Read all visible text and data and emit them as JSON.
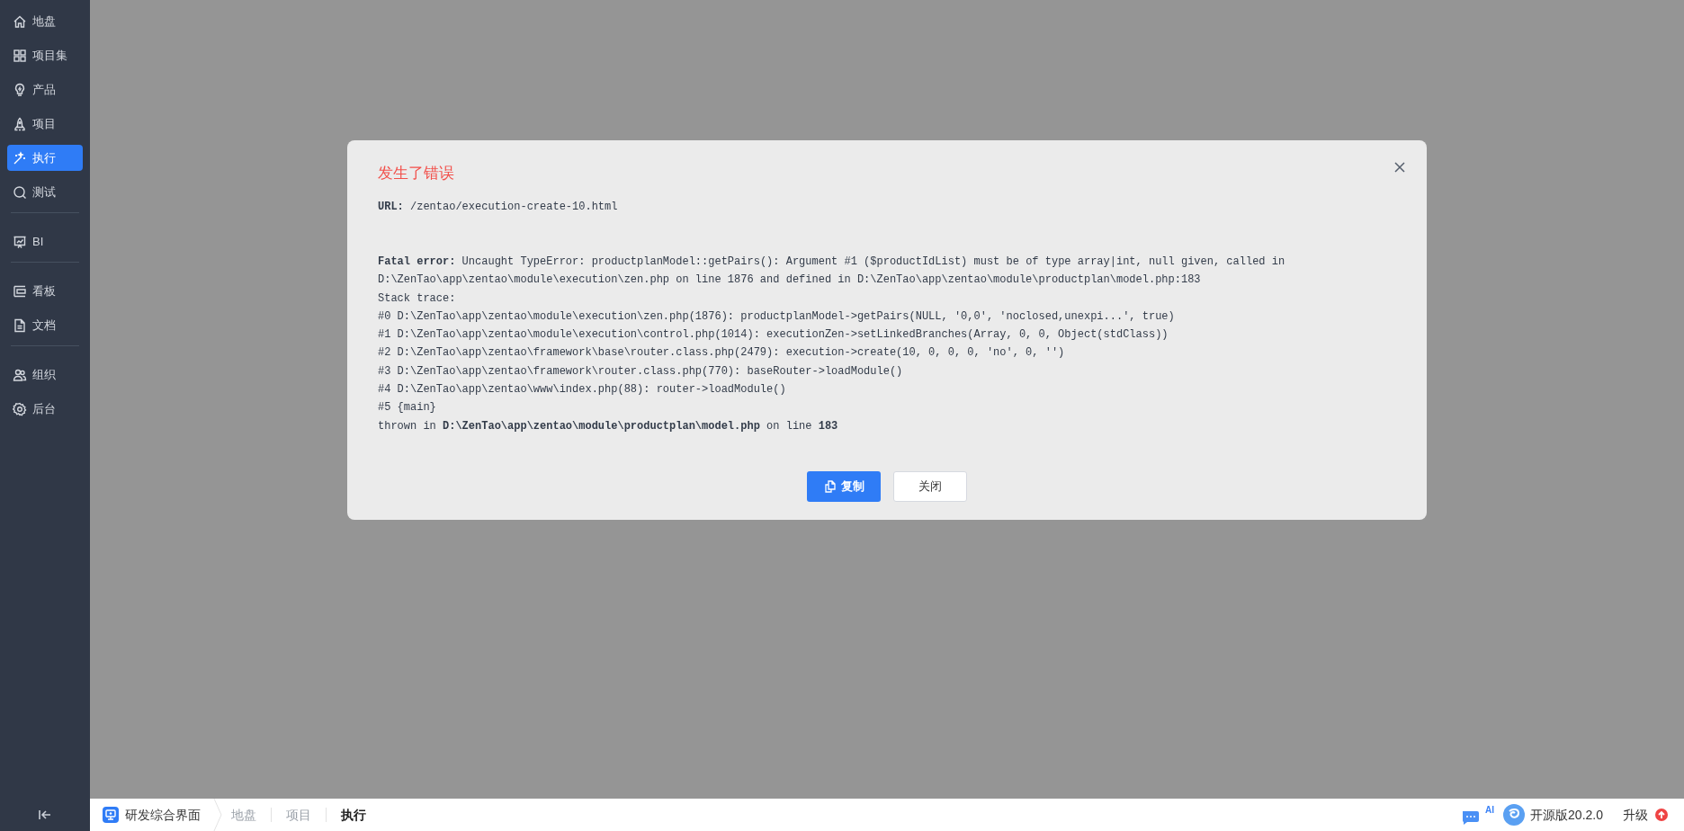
{
  "sidebar": {
    "groups": [
      [
        {
          "label": "地盘",
          "selected": false
        },
        {
          "label": "项目集",
          "selected": false
        },
        {
          "label": "产品",
          "selected": false
        },
        {
          "label": "项目",
          "selected": false
        },
        {
          "label": "执行",
          "selected": true
        },
        {
          "label": "测试",
          "selected": false
        }
      ],
      [
        {
          "label": "BI",
          "selected": false
        }
      ],
      [
        {
          "label": "看板",
          "selected": false
        },
        {
          "label": "文档",
          "selected": false
        }
      ],
      [
        {
          "label": "组织",
          "selected": false
        },
        {
          "label": "后台",
          "selected": false
        }
      ]
    ]
  },
  "dialog": {
    "title": "发生了错误",
    "url_line": "**URL:** /zentao/execution-create-10.html",
    "error_lines": [
      "**Fatal error:** Uncaught TypeError: productplanModel::getPairs(): Argument #1 ($productIdList) must be of type array|int, null given, called in",
      "D:\\ZenTao\\app\\zentao\\module\\execution\\zen.php on line 1876 and defined in D:\\ZenTao\\app\\zentao\\module\\productplan\\model.php:183",
      "Stack trace:",
      "#0 D:\\ZenTao\\app\\zentao\\module\\execution\\zen.php(1876): productplanModel->getPairs(NULL, '0,0', 'noclosed,unexpi...', true)",
      "#1 D:\\ZenTao\\app\\zentao\\module\\execution\\control.php(1014): executionZen->setLinkedBranches(Array, 0, 0, Object(stdClass))",
      "#2 D:\\ZenTao\\app\\zentao\\framework\\base\\router.class.php(2479): execution->create(10, 0, 0, 0, 'no', 0, '')",
      "#3 D:\\ZenTao\\app\\zentao\\framework\\router.class.php(770): baseRouter->loadModule()",
      "#4 D:\\ZenTao\\app\\zentao\\www\\index.php(88): router->loadModule()",
      "#5 {main}",
      "thrown in **D:\\ZenTao\\app\\zentao\\module\\productplan\\model.php** on line **183**"
    ],
    "buttons": [
      {
        "label": "复制",
        "kind": "primary"
      },
      {
        "label": "关闭",
        "kind": "default"
      }
    ]
  },
  "bottom_bar": {
    "app_name": "研发综合界面",
    "breadcrumbs": [
      {
        "label": "地盘",
        "selected": false
      },
      {
        "label": "项目",
        "selected": false
      },
      {
        "label": "执行",
        "selected": true
      }
    ],
    "ai_label": "AI",
    "edition": "开源版20.2.0",
    "upgrade": "升级"
  }
}
